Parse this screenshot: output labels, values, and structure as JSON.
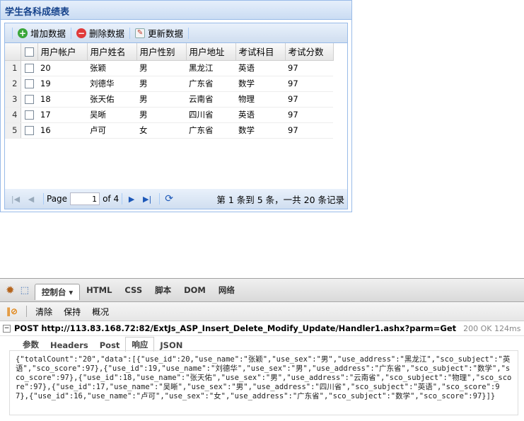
{
  "panel": {
    "title": "学生各科成绩表",
    "toolbar": {
      "add": "增加数据",
      "delete": "删除数据",
      "update": "更新数据"
    },
    "columns": [
      "用户帐户",
      "用户姓名",
      "用户性别",
      "用户地址",
      "考试科目",
      "考试分数"
    ],
    "rows": [
      {
        "n": "1",
        "id": "20",
        "name": "张颖",
        "sex": "男",
        "addr": "黑龙江",
        "subj": "英语",
        "score": "97"
      },
      {
        "n": "2",
        "id": "19",
        "name": "刘德华",
        "sex": "男",
        "addr": "广东省",
        "subj": "数学",
        "score": "97"
      },
      {
        "n": "3",
        "id": "18",
        "name": "张天佑",
        "sex": "男",
        "addr": "云南省",
        "subj": "物理",
        "score": "97"
      },
      {
        "n": "4",
        "id": "17",
        "name": "吴晰",
        "sex": "男",
        "addr": "四川省",
        "subj": "英语",
        "score": "97"
      },
      {
        "n": "5",
        "id": "16",
        "name": "卢可",
        "sex": "女",
        "addr": "广东省",
        "subj": "数学",
        "score": "97"
      }
    ],
    "paging": {
      "page_label": "Page",
      "page_value": "1",
      "of_label": "of 4",
      "info": "第 1 条到 5 条，一共 20 条记录"
    }
  },
  "firebug": {
    "tabs": [
      "控制台",
      "HTML",
      "CSS",
      "脚本",
      "DOM",
      "网络"
    ],
    "toolbar": [
      "清除",
      "保持",
      "概况"
    ],
    "request": {
      "text": "POST http://113.83.168.72:82/ExtJs_ASP_Insert_Delete_Modify_Update/Handler1.ashx?parm=Get",
      "status": "200 OK 124ms"
    },
    "subtabs": [
      "参数",
      "Headers",
      "Post",
      "响应",
      "JSON"
    ],
    "response": "{\"totalCount\":\"20\",\"data\":[{\"use_id\":20,\"use_name\":\"张颖\",\"use_sex\":\"男\",\"use_address\":\"黑龙江\",\"sco_subject\":\"英语\",\"sco_score\":97},{\"use_id\":19,\"use_name\":\"刘德华\",\"use_sex\":\"男\",\"use_address\":\"广东省\",\"sco_subject\":\"数学\",\"sco_score\":97},{\"use_id\":18,\"use_name\":\"张天佑\",\"use_sex\":\"男\",\"use_address\":\"云南省\",\"sco_subject\":\"物理\",\"sco_score\":97},{\"use_id\":17,\"use_name\":\"吴晰\",\"use_sex\":\"男\",\"use_address\":\"四川省\",\"sco_subject\":\"英语\",\"sco_score\":97},{\"use_id\":16,\"use_name\":\"卢可\",\"use_sex\":\"女\",\"use_address\":\"广东省\",\"sco_subject\":\"数学\",\"sco_score\":97}]}"
  }
}
